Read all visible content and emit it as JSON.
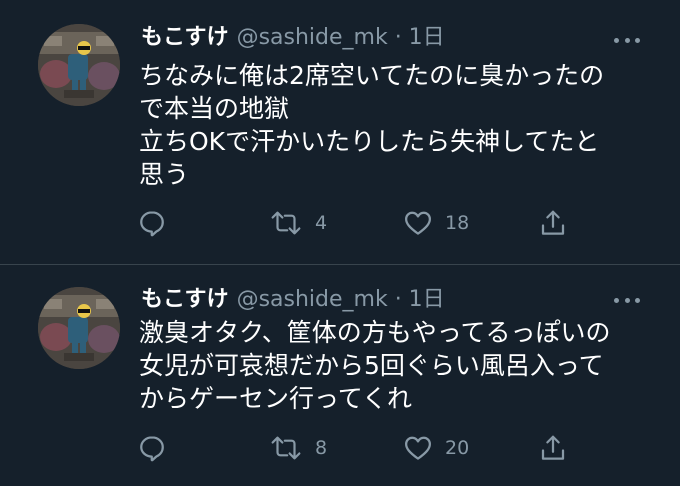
{
  "tweets": [
    {
      "display_name": "もこすけ",
      "handle_time": "@sashide_mk · 1日",
      "lines": [
        "ちなみに俺は2席空いてたのに臭かったの",
        "で本当の地獄",
        "立ちOKで汗かいたりしたら失神してたと",
        "思う"
      ],
      "retweets": "4",
      "likes": "18"
    },
    {
      "display_name": "もこすけ",
      "handle_time": "@sashide_mk · 1日",
      "lines": [
        "激臭オタク、筐体の方もやってるっぽいの",
        "女児が可哀想だから5回ぐらい風呂入って",
        "からゲーセン行ってくれ"
      ],
      "retweets": "8",
      "likes": "20"
    }
  ],
  "icons": {
    "reply": "reply-icon",
    "retweet": "retweet-icon",
    "like": "heart-icon",
    "share": "share-icon",
    "more": "more-icon"
  },
  "colors": {
    "background": "#15202b",
    "text": "#ffffff",
    "secondary": "#8899a6",
    "divider": "#38444d"
  }
}
